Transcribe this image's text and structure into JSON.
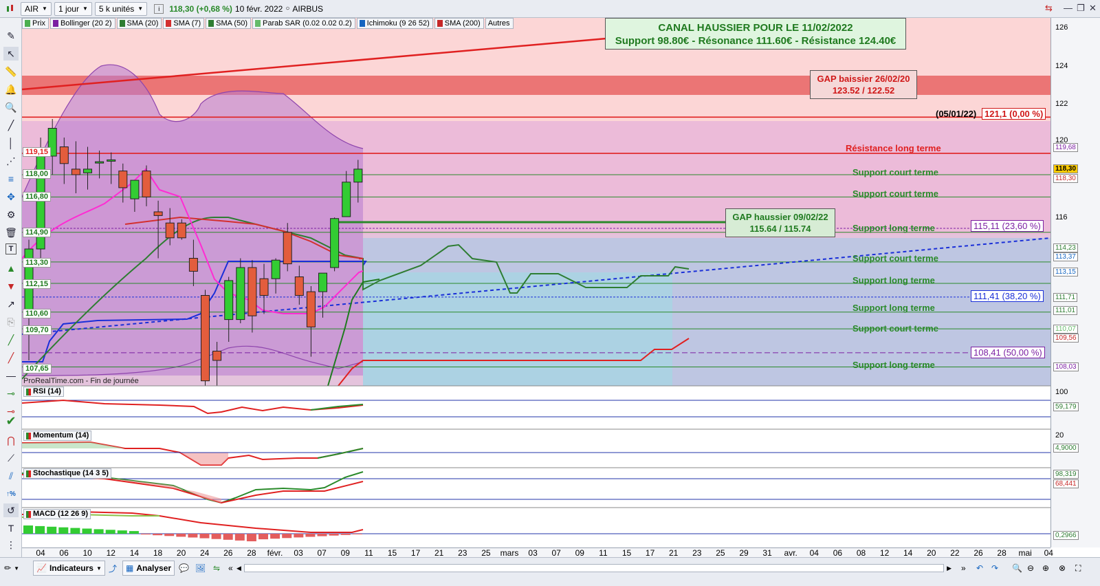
{
  "toolbar": {
    "symbol": "AIR",
    "period": "1 jour",
    "units": "5 k unités",
    "last_price": "118,30 (+0,68 %)",
    "date": "10 févr. 2022",
    "name": "AIRBUS"
  },
  "indicators": [
    {
      "label": "Prix",
      "color": "#4caf50"
    },
    {
      "label": "Bollinger (20 2)",
      "color": "#7b1fa2"
    },
    {
      "label": "SMA (20)",
      "color": "#2e7d32"
    },
    {
      "label": "SMA (7)",
      "color": "#d32f2f"
    },
    {
      "label": "SMA (50)",
      "color": "#2e7d32"
    },
    {
      "label": "Parab SAR (0.02 0.02 0.2)",
      "color": "#66bb6a"
    },
    {
      "label": "Ichimoku (9 26 52)",
      "color": "#1565c0"
    },
    {
      "label": "SMA (200)",
      "color": "#c62828"
    },
    {
      "label": "Autres",
      "color": ""
    }
  ],
  "annotations": {
    "canal_title": "CANAL HAUSSIER POUR LE 11/02/2022",
    "canal_sub": "Support 98.80€ - Résonance 111.60€ - Résistance 124.40€",
    "gap_bear_title": "GAP baissier 26/02/20",
    "gap_bear_values": "123.52 / 122.52",
    "gap_bull_title": "GAP haussier 09/02/22",
    "gap_bull_values": "115.64 / 115.74",
    "ref_date": "(05/01/22)",
    "ref_value": "121,1 (0,00 %)",
    "fib_23": "115,11 (23,60 %)",
    "fib_38": "111,41 (38,20 %)",
    "fib_50": "108,41 (50,00 %)",
    "watermark": "ProRealTime.com - Fin de journée"
  },
  "levels": [
    {
      "label": "Résistance long terme",
      "color": "#e02020"
    },
    {
      "label": "Support court terme",
      "color": "#2a8a2a"
    },
    {
      "label": "Support court terme",
      "color": "#2a8a2a"
    },
    {
      "label": "Support  long terme",
      "color": "#2a8a2a"
    },
    {
      "label": "Support court terme",
      "color": "#2a8a2a"
    },
    {
      "label": "Support  long terme",
      "color": "#2a8a2a"
    },
    {
      "label": "Support  long terme",
      "color": "#2a8a2a"
    },
    {
      "label": "Support court terme",
      "color": "#2a8a2a"
    },
    {
      "label": "Support  long terme",
      "color": "#2a8a2a"
    }
  ],
  "left_price_tags": [
    "119,15",
    "118,00",
    "116,80",
    "114,90",
    "113,30",
    "112,15",
    "110,60",
    "109,70",
    "107,65"
  ],
  "right_axis": {
    "ticks": [
      "126",
      "124",
      "122",
      "120",
      "116",
      "100",
      "20"
    ],
    "tags": [
      {
        "text": "119,68",
        "color": "#7b1fa2"
      },
      {
        "text": "118,30",
        "color": "#000000"
      },
      {
        "text": "118,30",
        "color": "#c62828"
      },
      {
        "text": "114,23",
        "color": "#2e7d32"
      },
      {
        "text": "113,37",
        "color": "#1565c0"
      },
      {
        "text": "113,15",
        "color": "#1565c0"
      },
      {
        "text": "111,71",
        "color": "#2e7d32"
      },
      {
        "text": "111,01",
        "color": "#2e7d32"
      },
      {
        "text": "110,07",
        "color": "#66bb6a"
      },
      {
        "text": "109,56",
        "color": "#c62828"
      },
      {
        "text": "108,03",
        "color": "#7b1fa2"
      },
      {
        "text": "59,179",
        "color": "#2e7d32"
      },
      {
        "text": "4,9000",
        "color": "#2e7d32"
      },
      {
        "text": "98,319",
        "color": "#2e7d32"
      },
      {
        "text": "68,441",
        "color": "#c62828"
      },
      {
        "text": "0,2966",
        "color": "#2e7d32"
      }
    ]
  },
  "panes": [
    {
      "label": "RSI (14)"
    },
    {
      "label": "Momentum (14)"
    },
    {
      "label": "Stochastique (14 3 5)"
    },
    {
      "label": "MACD (12 26 9)"
    }
  ],
  "x_axis": [
    "04",
    "06",
    "10",
    "12",
    "14",
    "18",
    "20",
    "24",
    "26",
    "28",
    "févr.",
    "03",
    "07",
    "09",
    "11",
    "15",
    "17",
    "21",
    "23",
    "25",
    "mars",
    "03",
    "07",
    "09",
    "11",
    "15",
    "17",
    "21",
    "23",
    "25",
    "29",
    "31",
    "avr.",
    "04",
    "06",
    "08",
    "12",
    "14",
    "20",
    "22",
    "26",
    "28",
    "mai",
    "04"
  ],
  "bottom": {
    "indicators_label": "Indicateurs",
    "analyze_label": "Analyser"
  },
  "chart_data": {
    "type": "candlestick",
    "symbol": "AIR",
    "candles": [
      {
        "x": "04",
        "open": 110.5,
        "high": 114.5,
        "low": 108.0,
        "close": 114.0
      },
      {
        "x": "05",
        "open": 114.0,
        "high": 120.0,
        "low": 113.5,
        "close": 119.0
      },
      {
        "x": "06",
        "open": 119.0,
        "high": 121.0,
        "low": 118.0,
        "close": 120.5
      },
      {
        "x": "07",
        "open": 119.5,
        "high": 120.0,
        "low": 117.5,
        "close": 118.6
      },
      {
        "x": "10",
        "open": 118.3,
        "high": 119.8,
        "low": 117.0,
        "close": 118.0
      },
      {
        "x": "11",
        "open": 118.1,
        "high": 119.5,
        "low": 117.2,
        "close": 118.3
      },
      {
        "x": "12",
        "open": 118.7,
        "high": 119.3,
        "low": 117.8,
        "close": 118.7
      },
      {
        "x": "13",
        "open": 118.8,
        "high": 119.2,
        "low": 117.5,
        "close": 118.8
      },
      {
        "x": "14",
        "open": 118.2,
        "high": 118.6,
        "low": 116.5,
        "close": 117.3
      },
      {
        "x": "17",
        "open": 116.7,
        "high": 117.5,
        "low": 116.0,
        "close": 117.7
      },
      {
        "x": "18",
        "open": 118.2,
        "high": 118.5,
        "low": 116.3,
        "close": 116.8
      },
      {
        "x": "19",
        "open": 116.0,
        "high": 116.6,
        "low": 113.5,
        "close": 115.8
      },
      {
        "x": "20",
        "open": 115.4,
        "high": 116.2,
        "low": 114.2,
        "close": 114.6
      },
      {
        "x": "21",
        "open": 115.4,
        "high": 115.6,
        "low": 114.5,
        "close": 114.6
      },
      {
        "x": "24",
        "open": 113.5,
        "high": 114.5,
        "low": 112.0,
        "close": 112.8
      },
      {
        "x": "25",
        "open": 111.5,
        "high": 111.8,
        "low": 106.5,
        "close": 106.9
      },
      {
        "x": "26",
        "open": 108.5,
        "high": 109.0,
        "low": 106.5,
        "close": 108.0
      },
      {
        "x": "27",
        "open": 110.2,
        "high": 112.5,
        "low": 109.0,
        "close": 112.3
      },
      {
        "x": "28",
        "open": 110.2,
        "high": 113.5,
        "low": 110.0,
        "close": 113.0
      },
      {
        "x": "31",
        "open": 113.0,
        "high": 113.4,
        "low": 109.5,
        "close": 110.4
      },
      {
        "x": "01",
        "open": 112.4,
        "high": 113.2,
        "low": 110.5,
        "close": 111.5
      },
      {
        "x": "02",
        "open": 112.4,
        "high": 113.5,
        "low": 111.6,
        "close": 113.4
      },
      {
        "x": "03",
        "open": 114.9,
        "high": 115.4,
        "low": 112.8,
        "close": 113.2
      },
      {
        "x": "04",
        "open": 112.5,
        "high": 113.1,
        "low": 111.0,
        "close": 111.5
      },
      {
        "x": "07",
        "open": 111.7,
        "high": 112.0,
        "low": 108.2,
        "close": 109.8
      },
      {
        "x": "08",
        "open": 111.7,
        "high": 112.7,
        "low": 110.3,
        "close": 112.7
      },
      {
        "x": "09",
        "open": 113.0,
        "high": 115.7,
        "low": 112.8,
        "close": 115.64
      },
      {
        "x": "10",
        "open": 115.74,
        "high": 118.2,
        "low": 115.74,
        "close": 117.6
      },
      {
        "x": "10b",
        "open": 117.6,
        "high": 118.8,
        "low": 116.5,
        "close": 118.3
      }
    ],
    "horizontal_levels": [
      121.1,
      119.15,
      118.0,
      116.8,
      114.9,
      113.3,
      112.15,
      110.6,
      109.7,
      107.65
    ],
    "fibonacci": [
      {
        "label": "23,60 %",
        "value": 115.11
      },
      {
        "label": "38,20 %",
        "value": 111.41
      },
      {
        "label": "50,00 %",
        "value": 108.41
      }
    ],
    "gaps": [
      {
        "label": "GAP baissier 26/02/20",
        "from": 122.52,
        "to": 123.52
      },
      {
        "label": "GAP haussier 09/02/22",
        "from": 115.64,
        "to": 115.74
      }
    ],
    "last_price": 118.3
  }
}
